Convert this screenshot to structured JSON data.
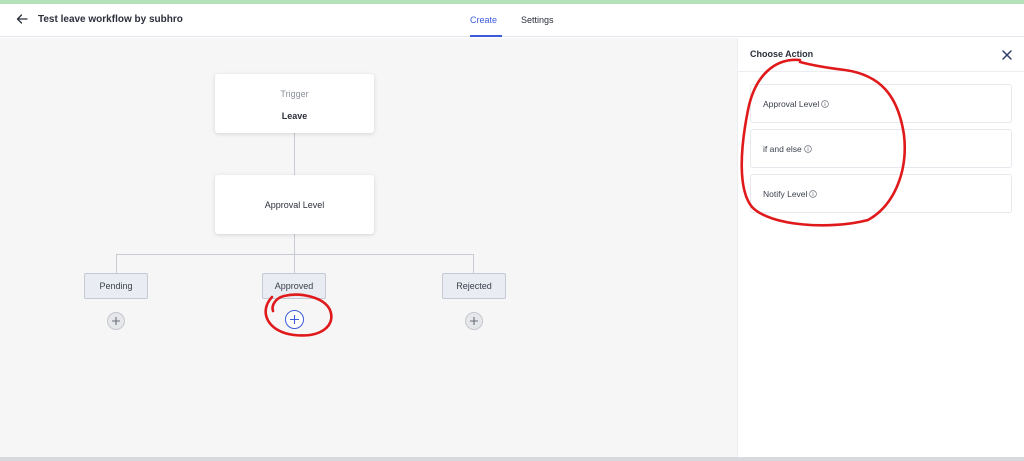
{
  "header": {
    "title": "Test leave workflow by subhro",
    "tabs": [
      {
        "label": "Create",
        "active": true
      },
      {
        "label": "Settings",
        "active": false
      }
    ]
  },
  "workflow": {
    "trigger": {
      "label": "Trigger",
      "value": "Leave"
    },
    "approval_node": {
      "label": "Approval Level"
    },
    "branches": [
      {
        "label": "Pending"
      },
      {
        "label": "Approved"
      },
      {
        "label": "Rejected"
      }
    ]
  },
  "panel": {
    "title": "Choose Action",
    "actions": [
      {
        "label": "Approval Level"
      },
      {
        "label": "if and else"
      },
      {
        "label": "Notify Level"
      }
    ]
  },
  "icons": {
    "back": "arrow-left-icon",
    "close": "close-icon",
    "add": "plus-circle-icon",
    "info": "info-circle-icon"
  },
  "colors": {
    "accent": "#3b5bdb",
    "annotation": "#e0191b",
    "canvas_bg": "#f6f6f7",
    "top_accent": "#b5e3b9"
  }
}
